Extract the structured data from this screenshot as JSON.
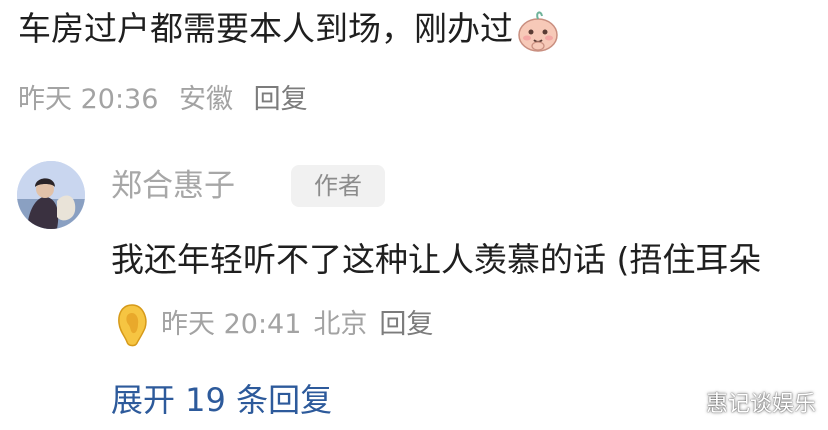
{
  "comment": {
    "text": "车房过户都需要本人到场，刚办过",
    "emoji": "smirk-bunny-emoji",
    "time": "昨天 20:36",
    "location": "安徽",
    "reply_label": "回复"
  },
  "reply": {
    "author": "郑合惠子",
    "badge": "作者",
    "text": "我还年轻听不了这种让人羡慕的话 (捂住耳朵",
    "emoji": "ear-icon",
    "time": "昨天 20:41",
    "location": "北京",
    "reply_label": "回复"
  },
  "expand": {
    "label": "展开 19 条回复"
  },
  "watermark": "惠记谈娱乐",
  "colors": {
    "text": "#1f1f1f",
    "meta": "#a3a3a3",
    "link": "#2d5a9b"
  }
}
